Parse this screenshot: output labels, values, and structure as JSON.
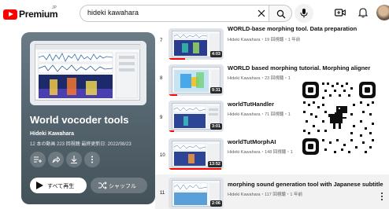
{
  "header": {
    "logo_text": "Premium",
    "logo_sup": "JP",
    "search_value": "hideki kawahara"
  },
  "playlist": {
    "title": "World vocoder tools",
    "author": "Hideki Kawahara",
    "meta": "12 本の動画  223 回視聴  最終更新日: 2022/08/23",
    "play_all_label": "すべて再生",
    "shuffle_label": "シャッフル"
  },
  "videos": [
    {
      "index": "7",
      "title": "WORLD-base morphing tool. Data preparation",
      "meta": "Hideki Kawahara・19 回視聴・1 年前",
      "duration": "4:03",
      "progress": 0.3
    },
    {
      "index": "8",
      "title": "WORLD based morphing tutorial. Morphing aligner",
      "meta": "Hideki Kawahara・23 回視聴・1",
      "duration": "9:31",
      "progress": 0.15
    },
    {
      "index": "9",
      "title": "worldTutHandler",
      "meta": "Hideki Kawahara・71 回視聴・1",
      "duration": "3:01",
      "progress": 0.1
    },
    {
      "index": "10",
      "title": "worldTutMorphAI",
      "meta": "Hideki Kawahara・148 回視聴・1",
      "duration": "13:52",
      "progress": 0.95
    },
    {
      "index": "11",
      "title": "morphing sound generation tool with Japanese subtitle",
      "meta": "Hideki Kawahara・117 回視聴・1 年前",
      "duration": "2:06",
      "progress": 0.0
    }
  ],
  "colors": {
    "brand_red": "#ff0000",
    "panel_top": "#6b7c86",
    "panel_bottom": "#445259"
  }
}
